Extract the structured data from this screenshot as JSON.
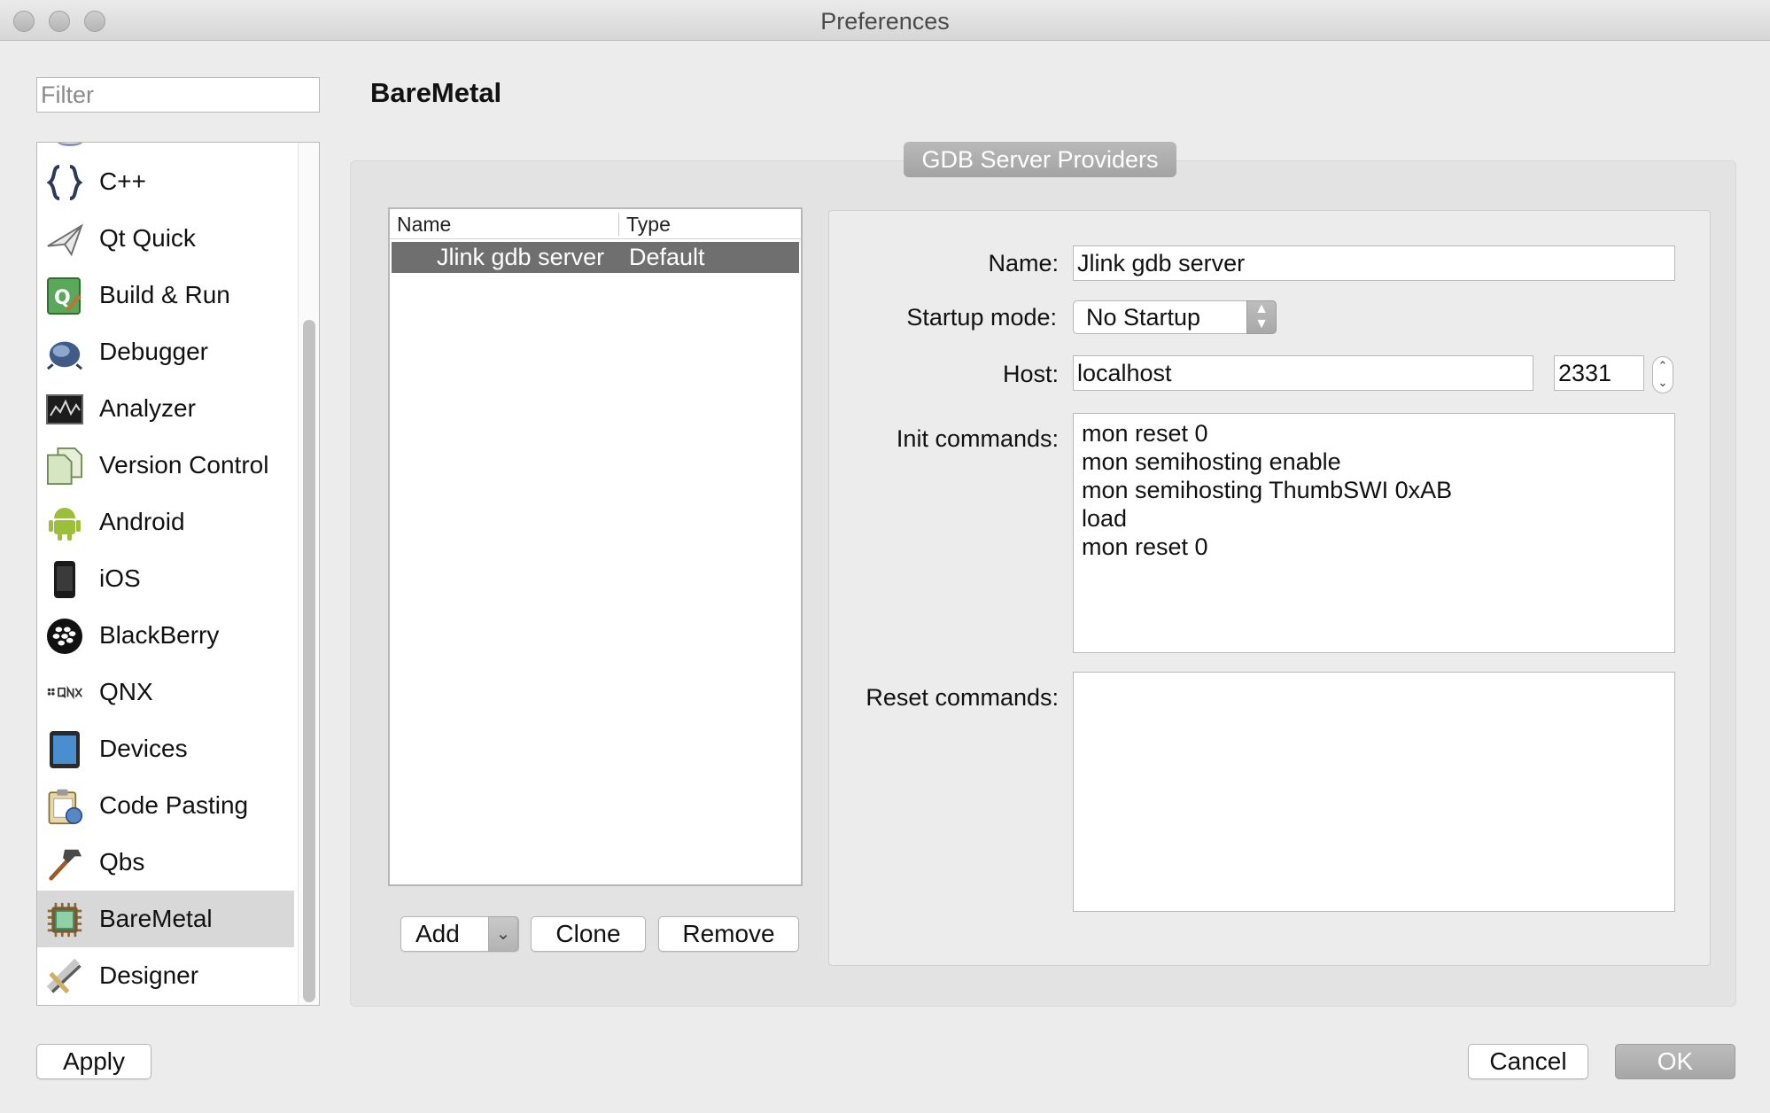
{
  "window": {
    "title": "Preferences"
  },
  "filter": {
    "placeholder": "Filter",
    "value": ""
  },
  "sidebar": {
    "items": [
      {
        "label": "C++",
        "icon": "braces-icon"
      },
      {
        "label": "Qt Quick",
        "icon": "paper-plane-icon"
      },
      {
        "label": "Build & Run",
        "icon": "build-run-icon"
      },
      {
        "label": "Debugger",
        "icon": "bug-icon"
      },
      {
        "label": "Analyzer",
        "icon": "analyzer-icon"
      },
      {
        "label": "Version Control",
        "icon": "documents-icon"
      },
      {
        "label": "Android",
        "icon": "android-icon"
      },
      {
        "label": "iOS",
        "icon": "iphone-icon"
      },
      {
        "label": "BlackBerry",
        "icon": "blackberry-icon"
      },
      {
        "label": "QNX",
        "icon": "qnx-icon"
      },
      {
        "label": "Devices",
        "icon": "tablet-icon"
      },
      {
        "label": "Code Pasting",
        "icon": "clipboard-icon"
      },
      {
        "label": "Qbs",
        "icon": "hammer-icon"
      },
      {
        "label": "BareMetal",
        "icon": "chip-icon",
        "selected": true
      },
      {
        "label": "Designer",
        "icon": "designer-icon"
      }
    ]
  },
  "page": {
    "title": "BareMetal",
    "group_title": "GDB Server Providers"
  },
  "providers": {
    "columns": [
      "Name",
      "Type"
    ],
    "rows": [
      {
        "name": "Jlink gdb server",
        "type": "Default"
      }
    ],
    "buttons": {
      "add": "Add",
      "clone": "Clone",
      "remove": "Remove"
    }
  },
  "details": {
    "name_label": "Name:",
    "name_value": "Jlink gdb server",
    "startup_label": "Startup mode:",
    "startup_value": "No Startup",
    "host_label": "Host:",
    "host_value": "localhost",
    "port_value": "2331",
    "init_label": "Init commands:",
    "init_value": "mon reset 0\nmon semihosting enable\nmon semihosting ThumbSWI 0xAB\nload\nmon reset 0",
    "reset_label": "Reset commands:",
    "reset_value": ""
  },
  "footer": {
    "apply": "Apply",
    "cancel": "Cancel",
    "ok": "OK"
  }
}
